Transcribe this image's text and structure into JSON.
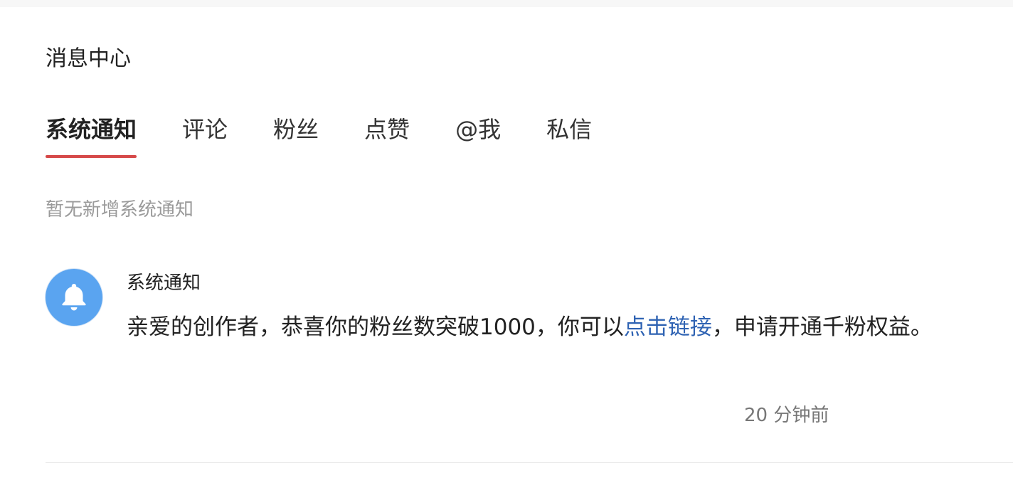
{
  "header": {
    "title": "消息中心"
  },
  "tabs": [
    {
      "label": "系统通知",
      "active": true
    },
    {
      "label": "评论",
      "active": false
    },
    {
      "label": "粉丝",
      "active": false
    },
    {
      "label": "点赞",
      "active": false
    },
    {
      "label": "@我",
      "active": false
    },
    {
      "label": "私信",
      "active": false
    }
  ],
  "empty_state": {
    "text": "暂无新增系统通知"
  },
  "notification": {
    "icon": "bell-icon",
    "title": "系统通知",
    "message_prefix": "亲爱的创作者，恭喜你的粉丝数突破1000，你可以",
    "link_text": "点击链接",
    "message_suffix": "，申请开通千粉权益。",
    "time": "20 分钟前"
  },
  "colors": {
    "accent": "#d64949",
    "link": "#2f63b3",
    "avatar": "#5aa4f0",
    "muted_text": "#9a9a9a"
  }
}
